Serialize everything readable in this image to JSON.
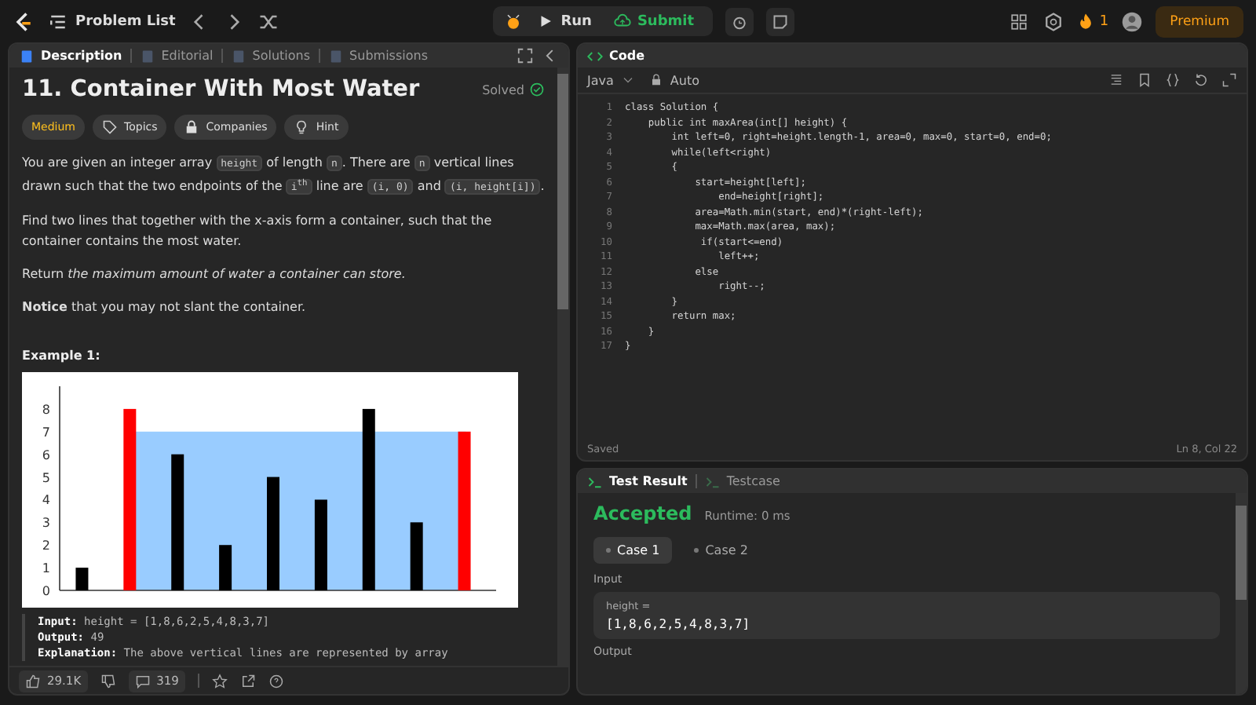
{
  "topbar": {
    "problem_list": "Problem List",
    "run": "Run",
    "submit": "Submit",
    "streak": "1",
    "premium": "Premium"
  },
  "description_panel": {
    "tabs": [
      {
        "label": "Description",
        "selected": true
      },
      {
        "label": "Editorial",
        "selected": false
      },
      {
        "label": "Solutions",
        "selected": false
      },
      {
        "label": "Submissions",
        "selected": false
      }
    ],
    "title": "11. Container With Most Water",
    "status": "Solved",
    "tags": [
      {
        "kind": "difficulty",
        "label": "Medium"
      },
      {
        "kind": "topics",
        "label": "Topics"
      },
      {
        "kind": "companies",
        "label": "Companies"
      },
      {
        "kind": "hint",
        "label": "Hint"
      }
    ],
    "paragraphs": [
      [
        {
          "kind": "text",
          "text": "You are given an integer array "
        },
        {
          "kind": "code",
          "text": "height"
        },
        {
          "kind": "text",
          "text": " of length "
        },
        {
          "kind": "code",
          "text": "n"
        },
        {
          "kind": "text",
          "text": ". There are "
        },
        {
          "kind": "code",
          "text": "n"
        },
        {
          "kind": "text",
          "text": " vertical lines drawn such that the two endpoints of the "
        },
        {
          "kind": "code",
          "text": "i$^{th}$"
        },
        {
          "kind": "text",
          "text": " line are "
        },
        {
          "kind": "code",
          "text": "(i, 0)"
        },
        {
          "kind": "text",
          "text": " and "
        },
        {
          "kind": "code",
          "text": "(i, height[i])"
        },
        {
          "kind": "text",
          "text": "."
        }
      ],
      [
        {
          "kind": "text",
          "text": "Find two lines that together with the x-axis form a container, such that the container contains the most water."
        }
      ],
      [
        {
          "kind": "text",
          "text": "Return *the maximum amount of water a container can store.*"
        }
      ],
      [
        {
          "kind": "text",
          "text": "**Notice** that you may not slant the container."
        }
      ]
    ],
    "example_title": "Example 1:",
    "chart_data": {
      "type": "bar",
      "stacked": true,
      "ylim": [
        0,
        9
      ],
      "yticks": [
        0,
        1,
        2,
        3,
        4,
        5,
        6,
        7,
        8
      ],
      "series": [
        {
          "color": "#000000",
          "values": [
            1,
            null,
            6,
            2,
            5,
            4,
            8,
            3,
            null
          ]
        },
        {
          "color": "#ff0000",
          "values": [
            null,
            8,
            null,
            null,
            null,
            null,
            null,
            null,
            7
          ]
        }
      ]
    },
    "example_lines": [
      {
        "label": "Input:",
        "value": "height = [1,8,6,2,5,4,8,3,7]"
      },
      {
        "label": "Output:",
        "value": "49"
      },
      {
        "label": "Explanation:",
        "value": "The above vertical lines are represented by array"
      }
    ],
    "footer": {
      "likes": "29.1K",
      "comments": "319"
    }
  },
  "code_panel": {
    "tab": "Code",
    "language": "Java",
    "mode": "Auto",
    "lines": [
      "class Solution {",
      "    public int maxArea(int[] height) {",
      "        int left=0, right=height.length-1, area=0, max=0, start=0, end=0;",
      "        while(left<right)",
      "        {",
      "            start=height[left];",
      "                end=height[right];",
      "            area=Math.min(start, end)*(right-left);",
      "            max=Math.max(area, max);",
      "             if(start<=end)",
      "                left++;",
      "            else",
      "                right--;",
      "        }",
      "        return max;",
      "    }",
      "}"
    ],
    "line_numbers": [
      "1",
      "2",
      "3",
      "4",
      "5",
      "6",
      "7",
      "8",
      "9",
      "10",
      "11",
      "12",
      "13",
      "14",
      "15",
      "16",
      "17"
    ],
    "status": "Saved",
    "cursor": "Ln 8, Col 22"
  },
  "test_panel": {
    "tabs": [
      {
        "label": "Test Result",
        "selected": true
      },
      {
        "label": "Testcase",
        "selected": false
      }
    ],
    "result": "Accepted",
    "runtime": "Runtime: 0 ms",
    "cases": [
      {
        "label": "Case 1",
        "selected": true
      },
      {
        "label": "Case 2",
        "selected": false
      }
    ],
    "input_label": "Input",
    "param_name": "height =",
    "param_value": "[1,8,6,2,5,4,8,3,7]",
    "output_label": "Output"
  }
}
